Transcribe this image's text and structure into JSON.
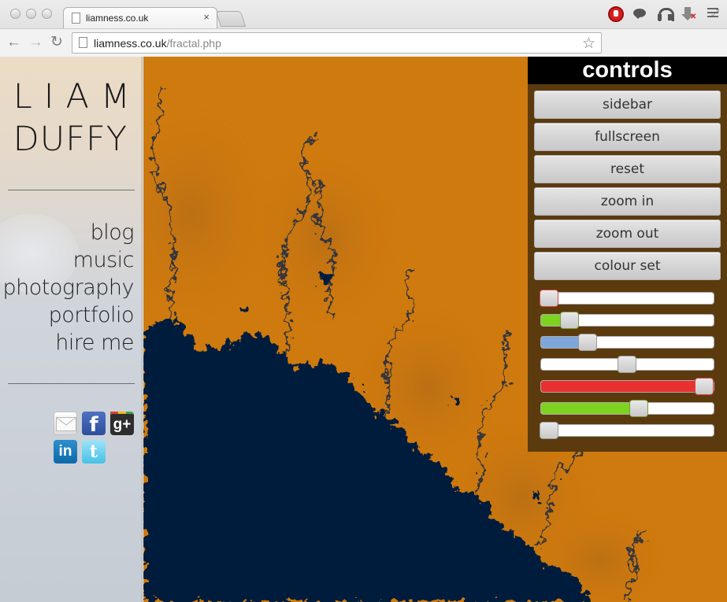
{
  "browser": {
    "tab_title": "liamness.co.uk",
    "tab_close": "×",
    "url_host": "liamness.co.uk",
    "url_path": "/fractal.php",
    "back_glyph": "←",
    "forward_glyph": "→",
    "reload_glyph": "↻",
    "star_glyph": "☆",
    "restore_glyph": "⤢",
    "ext_download_badge": "✕"
  },
  "sidebar": {
    "name_first": "LIAM",
    "name_last": "DUFFY",
    "nav": [
      {
        "label": "blog"
      },
      {
        "label": "music"
      },
      {
        "label": "photography"
      },
      {
        "label": "portfolio"
      },
      {
        "label": "hire me"
      }
    ],
    "social": {
      "facebook_glyph": "f",
      "google_glyph": "g+",
      "linkedin_glyph": "in",
      "twitter_glyph": "t"
    }
  },
  "controls": {
    "title": "controls",
    "buttons": [
      {
        "label": "sidebar"
      },
      {
        "label": "fullscreen"
      },
      {
        "label": "reset"
      },
      {
        "label": "zoom in"
      },
      {
        "label": "zoom out"
      },
      {
        "label": "colour set"
      }
    ],
    "sliders": [
      {
        "value": 0.0,
        "fill_color": "#e03030",
        "handle": "red"
      },
      {
        "value": 0.13,
        "fill_color": "#7ed321",
        "handle": "green"
      },
      {
        "value": 0.25,
        "fill_color": "#7ea6d9",
        "handle": "blue"
      },
      {
        "value": 0.5,
        "fill_color": "",
        "handle": "neutral"
      },
      {
        "value": 1.0,
        "fill_color": "#e83030",
        "handle": "red"
      },
      {
        "value": 0.58,
        "fill_color": "#7ed321",
        "handle": "green"
      },
      {
        "value": 0.0,
        "fill_color": "#7ea6d9",
        "handle": "blue"
      }
    ]
  },
  "colors": {
    "fractal_background": "#cf7a0e",
    "fractal_set": "#021e3d",
    "controls_panel": "#5b3a0e"
  }
}
